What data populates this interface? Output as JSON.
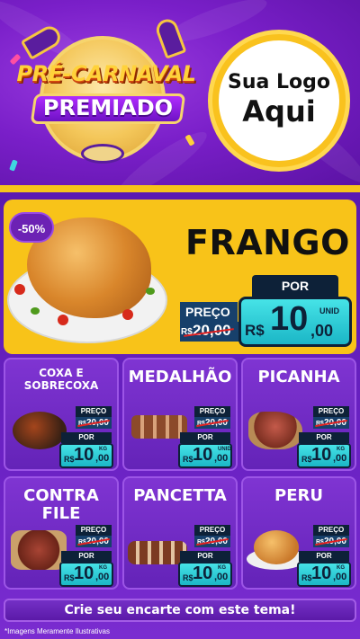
{
  "header": {
    "badge_line1": "PRÉ-CARNAVAL",
    "badge_line2": "PREMIADO",
    "logo_line1": "Sua Logo",
    "logo_line2": "Aqui"
  },
  "featured": {
    "discount": "-50%",
    "name": "FRANGO",
    "preco_label": "PREÇO",
    "old_currency": "R$",
    "old_price": "20,00",
    "por_label": "POR",
    "new_currency": "R$",
    "new_integer": "10",
    "new_cents": ",00",
    "unit": "UNID"
  },
  "products": [
    {
      "name": "COXA E SOBRECOXA",
      "preco_label": "PREÇO",
      "old_currency": "R$",
      "old_price": "20,00",
      "por_label": "POR",
      "currency": "R$",
      "integer": "10",
      "cents": ",00",
      "unit": "KG"
    },
    {
      "name": "MEDALHÃO",
      "preco_label": "PREÇO",
      "old_currency": "R$",
      "old_price": "20,00",
      "por_label": "POR",
      "currency": "R$",
      "integer": "10",
      "cents": ",00",
      "unit": "UNID"
    },
    {
      "name": "PICANHA",
      "preco_label": "PREÇO",
      "old_currency": "R$",
      "old_price": "20,00",
      "por_label": "POR",
      "currency": "R$",
      "integer": "10",
      "cents": ",00",
      "unit": "KG"
    },
    {
      "name": "CONTRA FILE",
      "preco_label": "PREÇO",
      "old_currency": "R$",
      "old_price": "20,00",
      "por_label": "POR",
      "currency": "R$",
      "integer": "10",
      "cents": ",00",
      "unit": "KG"
    },
    {
      "name": "PANCETTA",
      "preco_label": "PREÇO",
      "old_currency": "R$",
      "old_price": "20,00",
      "por_label": "POR",
      "currency": "R$",
      "integer": "10",
      "cents": ",00",
      "unit": "KG"
    },
    {
      "name": "PERU",
      "preco_label": "PREÇO",
      "old_currency": "R$",
      "old_price": "20,00",
      "por_label": "POR",
      "currency": "R$",
      "integer": "10",
      "cents": ",00",
      "unit": "KG"
    }
  ],
  "footer": {
    "cta": "Crie seu encarte com este tema!",
    "disclaimer": "*Imagens Meramente Ilustrativas"
  },
  "colors": {
    "purple": "#6b22c4",
    "yellow": "#f8c319",
    "teal": "#2ccbd6",
    "navy": "#0d2138"
  }
}
